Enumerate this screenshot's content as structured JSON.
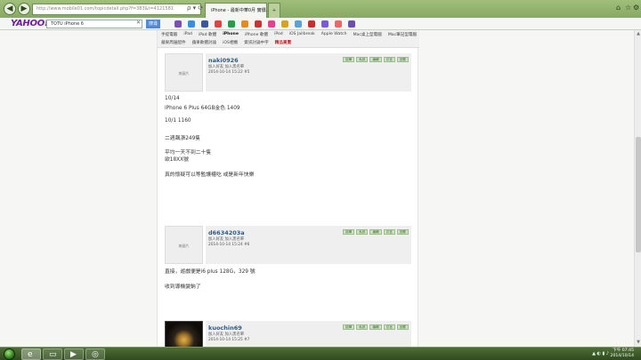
{
  "browser": {
    "address": "http://www.mobile01.com/topicdetail.php?f=383&t=4121581",
    "active_tab": "iPhone - 最新中華0月 實價...",
    "new_tab": "+",
    "win_controls": [
      "⌂",
      "☆",
      "⚙"
    ],
    "addr_tools": "ρ ▾ ⟳ ✕"
  },
  "search_bar": {
    "brand": "YAHOO!",
    "value": "TOTU iPhone 6",
    "clear": "✕",
    "button": "搜尋"
  },
  "category_nav": {
    "row1": [
      "手提電腦",
      "iPad",
      "iPad 軟體",
      "iPhone",
      "iPhone 軟體",
      "iPod",
      "iOS Jailbreak",
      "Apple Watch",
      "Mac桌上型電腦",
      "Mac筆記型電腦"
    ],
    "row1_bold_index": 3,
    "row2": [
      "蘋果周邊配件",
      "蘋果軟體討論",
      "iOS相機",
      "資訊討論中字",
      "精品買賣"
    ],
    "row2_highlight_index": 4
  },
  "posts": [
    {
      "username": "naki0926",
      "meta1": "加入好友  加入黑名單",
      "meta2": "2014-10-14 15:22  #5",
      "avatar_label": "無圖片",
      "buttons": [
        "檢舉",
        "私訊",
        "編輯",
        "引言",
        "回覆"
      ],
      "lines": [
        "10/14",
        "iPhone 6 Plus 64GB金色 1409",
        "",
        "10/1 1160",
        "",
        "二週飆漲249隻",
        "",
        "平均一天不到二十隻",
        "欲18XX號",
        "",
        "真的懷疑可以等監護權吃 或是新年快樂"
      ]
    },
    {
      "username": "d6634203a",
      "meta1": "加入好友  加入黑名單",
      "meta2": "2014-10-14 15:24  #6",
      "avatar_label": "無圖片",
      "buttons": [
        "檢舉",
        "私訊",
        "編輯",
        "引言",
        "回覆"
      ],
      "lines": [
        "直接，遊戲便是i6 plus 128G，329 號",
        "",
        "收到導機變鈉了"
      ]
    },
    {
      "username": "kuochin69",
      "meta1": "加入好友  加入黑名單",
      "meta2": "2014-10-14 15:25  #7",
      "avatar_label": "",
      "buttons": [
        "檢舉",
        "私訊",
        "編輯",
        "引言",
        "回覆"
      ],
      "lines": []
    }
  ],
  "taskbar": {
    "time": "下午 07:45",
    "date": "2014/10/14",
    "tray_icons": "▲ ◐ ▮ ♪"
  },
  "colors": {
    "username": "#2b5a8c",
    "button_bg": "#cfe3c4",
    "highlight": "#c0272d"
  }
}
